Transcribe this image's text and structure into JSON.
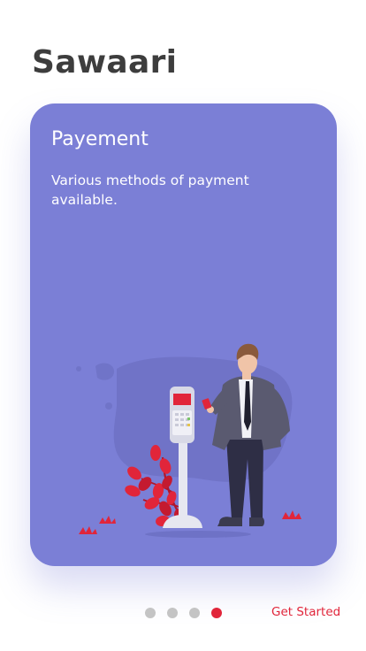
{
  "app": {
    "title": "Sawaari"
  },
  "card": {
    "title": "Payement",
    "description": "Various methods of payment available.",
    "background": "#7b7fd6"
  },
  "pager": {
    "total": 4,
    "active_index": 3
  },
  "actions": {
    "get_started_label": "Get Started"
  },
  "colors": {
    "accent": "#e1253a",
    "title_text": "#3d3d3d",
    "dot_inactive": "#c4c4c4"
  },
  "illustration": {
    "icon": "payment-terminal-man-illustration"
  }
}
